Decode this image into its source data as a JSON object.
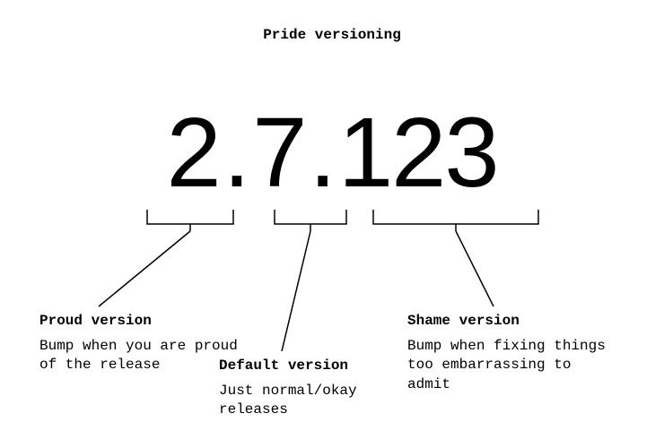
{
  "title": "Pride versioning",
  "version": {
    "major": "2",
    "minor": "7",
    "patch": "123"
  },
  "captions": {
    "left": {
      "heading": "Proud version",
      "text": "Bump when you are proud of the release"
    },
    "center": {
      "heading": "Default version",
      "text": "Just normal/okay releases"
    },
    "right": {
      "heading": "Shame version",
      "text": "Bump when fixing things too embarrassing to admit"
    }
  }
}
